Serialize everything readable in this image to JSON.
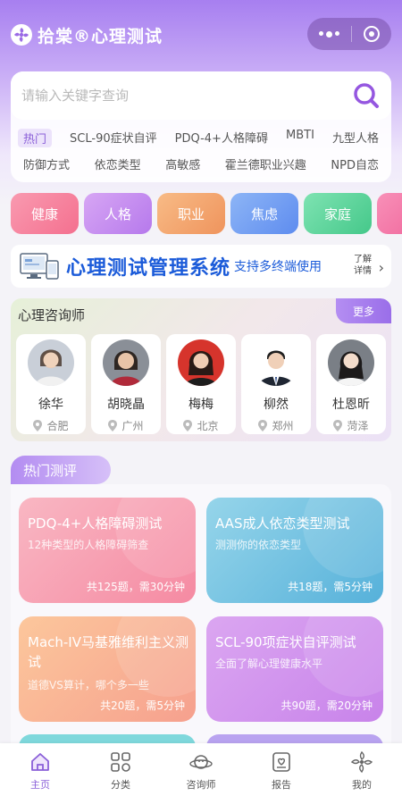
{
  "header": {
    "title": "拾棠®心理测试"
  },
  "search": {
    "placeholder": "请输入关键字查询",
    "hot_label": "热门",
    "tags_row1": [
      "SCL-90症状自评",
      "PDQ-4+人格障碍",
      "MBTI",
      "九型人格"
    ],
    "tags_row2": [
      "防御方式",
      "依恋类型",
      "高敏感",
      "霍兰德职业兴趣",
      "NPD自恋"
    ]
  },
  "categories": [
    {
      "label": "健康",
      "color": "#f77f9c"
    },
    {
      "label": "人格",
      "color": "#c48af0"
    },
    {
      "label": "职业",
      "color": "#f3a46a"
    },
    {
      "label": "焦虑",
      "color": "#6f9cf1"
    },
    {
      "label": "家庭",
      "color": "#58d29a"
    }
  ],
  "banner": {
    "title": "心理测试管理系统",
    "subtitle": "支持多终端使用",
    "more_line1": "了解",
    "more_line2": "详情"
  },
  "counselors": {
    "heading": "心理咨询师",
    "more": "更多",
    "items": [
      {
        "name": "徐华",
        "city": "合肥"
      },
      {
        "name": "胡晓晶",
        "city": "广州"
      },
      {
        "name": "梅梅",
        "city": "北京"
      },
      {
        "name": "柳然",
        "city": "郑州"
      },
      {
        "name": "杜恩昕",
        "city": "菏泽"
      }
    ]
  },
  "hot_tests": {
    "heading": "热门测评",
    "items": [
      {
        "title": "PDQ-4+人格障碍测试",
        "desc": "12种类型的人格障碍筛查",
        "meta": "共125题，需30分钟",
        "color": "#f7a6b6",
        "color2": "#f88ea5"
      },
      {
        "title": "AAS成人依恋类型测试",
        "desc": "测测你的依恋类型",
        "meta": "共18题，需5分钟",
        "color": "#8dcde6",
        "color2": "#5bb5dc"
      },
      {
        "title": "Mach-IV马基雅维利主义测试",
        "desc": "道德VS算计，哪个多一些",
        "meta": "共20题，需5分钟",
        "color": "#fbc099",
        "color2": "#f7a48d"
      },
      {
        "title": "SCL-90项症状自评测试",
        "desc": "全面了解心理健康水平",
        "meta": "共90题，需20分钟",
        "color": "#d9a0ef",
        "color2": "#c985ea"
      }
    ]
  },
  "tabbar": {
    "items": [
      {
        "label": "主页",
        "icon": "home-icon"
      },
      {
        "label": "分类",
        "icon": "category-icon"
      },
      {
        "label": "咨询师",
        "icon": "counselor-icon"
      },
      {
        "label": "报告",
        "icon": "report-icon"
      },
      {
        "label": "我的",
        "icon": "profile-icon"
      }
    ]
  }
}
